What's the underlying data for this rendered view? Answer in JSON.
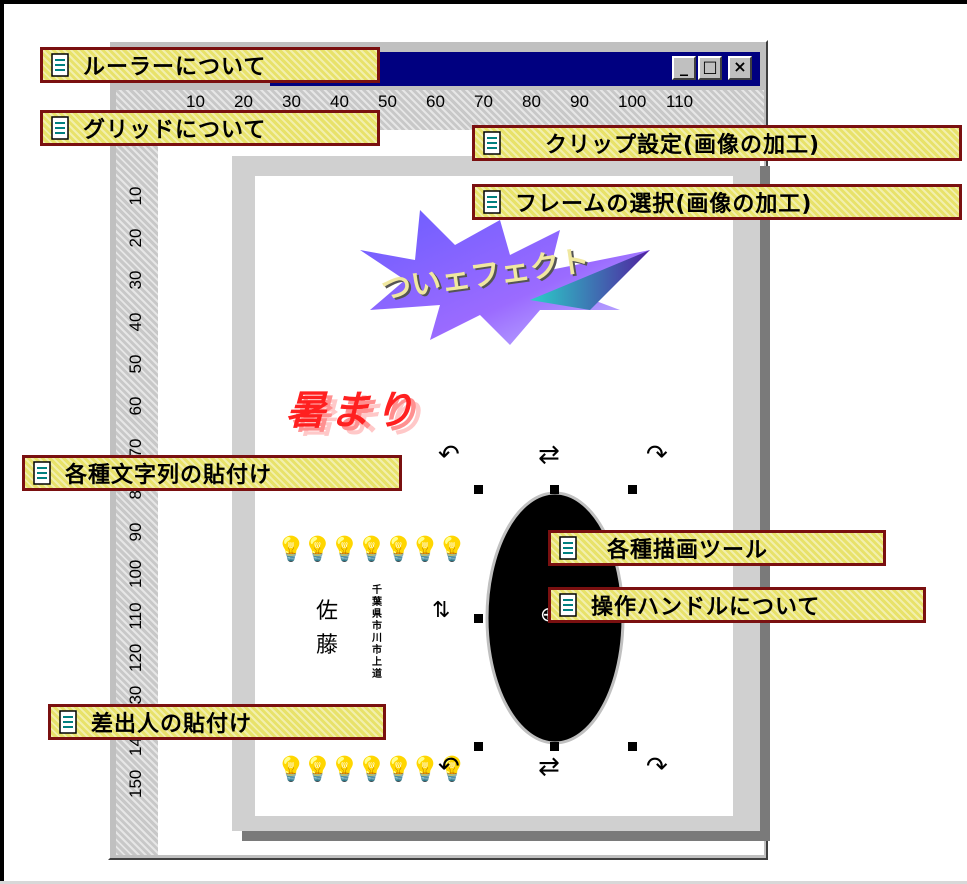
{
  "window": {
    "buttons": {
      "minimize": "_",
      "maximize": "□",
      "close": "×"
    }
  },
  "ruler": {
    "horizontal_ticks": [
      "10",
      "20",
      "30",
      "40",
      "50",
      "60",
      "70",
      "80",
      "90",
      "100",
      "110"
    ],
    "vertical_ticks": [
      "10",
      "20",
      "30",
      "40",
      "50",
      "60",
      "70",
      "80",
      "90",
      "100",
      "110",
      "120",
      "130",
      "140",
      "150"
    ]
  },
  "callouts": [
    {
      "label": "ルーラーについて"
    },
    {
      "label": "グリッドについて"
    },
    {
      "label": "クリップ設定(画像の加工)"
    },
    {
      "label": "フレームの選択(画像の加工)"
    },
    {
      "label": "各種文字列の貼付け"
    },
    {
      "label": "各種描画ツール"
    },
    {
      "label": "操作ハンドルについて"
    },
    {
      "label": "差出人の貼付け"
    }
  ],
  "card": {
    "burst_text": "ついェフェクト",
    "wave_text": "暑まり",
    "sender_name": [
      "佐",
      "藤"
    ],
    "sender_address": "千葉県市川市上道"
  },
  "icons": [
    "document-icon",
    "rotate-icon",
    "skew-icon",
    "resize-icon"
  ],
  "colors": {
    "titlebar": "#000080",
    "callout_bg": "#e8e26a",
    "callout_border": "#7a1010",
    "ellipse": "#000000"
  }
}
